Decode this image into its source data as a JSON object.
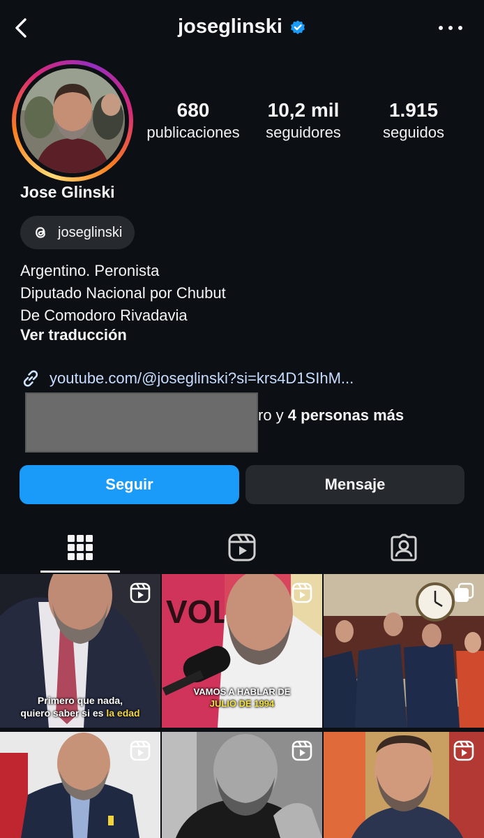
{
  "header": {
    "username": "joseglinski",
    "back_icon": "chevron-left-icon",
    "verified_icon": "verified-badge-icon",
    "more_icon": "more-horizontal-icon"
  },
  "stats": [
    {
      "value": "680",
      "label": "publicaciones"
    },
    {
      "value": "10,2 mil",
      "label": "seguidores"
    },
    {
      "value": "1.915",
      "label": "seguidos"
    }
  ],
  "profile": {
    "name": "Jose Glinski",
    "threads_handle": "joseglinski",
    "bio": [
      "Argentino. Peronista",
      "Diputado Nacional por Chubut",
      "De Comodoro Rivadavia"
    ],
    "translate": "Ver traducción",
    "link": "youtube.com/@joseglinski?si=krs4D1SIhM...",
    "followed_by_tail": "ro y ",
    "followed_by_more": "4 personas más"
  },
  "buttons": {
    "follow": "Seguir",
    "message": "Mensaje"
  },
  "tabs": [
    {
      "icon": "grid-icon",
      "active": true
    },
    {
      "icon": "reels-icon",
      "active": false
    },
    {
      "icon": "tagged-icon",
      "active": false
    }
  ],
  "posts": [
    {
      "caption_line1": "Primero que nada,",
      "caption_line2_a": "quiero saber si es ",
      "caption_line2_b": "la edad"
    },
    {
      "caption_line1": "VAMOS A HABLAR DE",
      "caption_line2": "JULIO DE 1994",
      "poster_text": "VOLVI"
    }
  ],
  "colors": {
    "accent": "#1a9bf9",
    "background": "#0c1014",
    "button_secondary": "#262a2e"
  }
}
